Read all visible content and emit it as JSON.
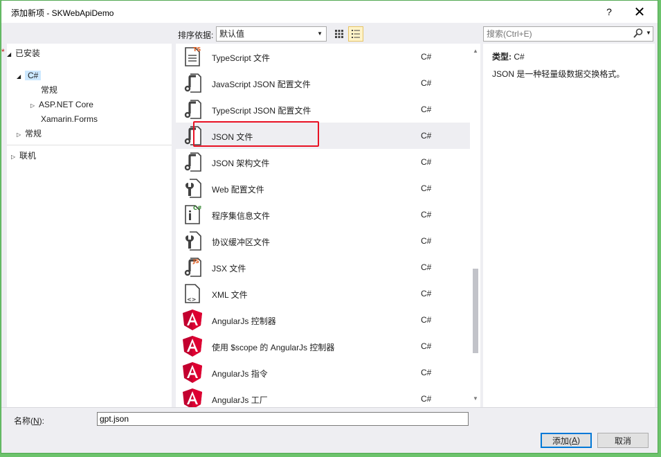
{
  "window": {
    "title": "添加新项 - SKWebApiDemo",
    "help_glyph": "?",
    "close_glyph": "✕"
  },
  "tree": {
    "installed_label": "已安装",
    "asterisk": "*",
    "items": [
      {
        "label": "C#",
        "arrow": "◢",
        "selected": true
      },
      {
        "label": "常规",
        "arrow": ""
      },
      {
        "label": "ASP.NET Core",
        "arrow": "▷"
      },
      {
        "label": "Xamarin.Forms",
        "arrow": ""
      },
      {
        "label": "常规",
        "arrow": "▷"
      },
      {
        "label": "联机",
        "arrow": "▷"
      }
    ]
  },
  "toolbar": {
    "sort_label": "排序依据:",
    "sort_value": "默认值",
    "grid_view_icon": "grid-view-icon",
    "list_view_icon": "list-view-icon"
  },
  "templates": [
    {
      "name": "TypeScript 文件",
      "lang": "C#",
      "icon": "typescript-file-icon"
    },
    {
      "name": "JavaScript JSON 配置文件",
      "lang": "C#",
      "icon": "json-config-icon"
    },
    {
      "name": "TypeScript JSON 配置文件",
      "lang": "C#",
      "icon": "json-config-icon"
    },
    {
      "name": "JSON 文件",
      "lang": "C#",
      "icon": "json-file-icon",
      "selected": true
    },
    {
      "name": "JSON 架构文件",
      "lang": "C#",
      "icon": "json-schema-icon"
    },
    {
      "name": "Web 配置文件",
      "lang": "C#",
      "icon": "web-config-icon"
    },
    {
      "name": "程序集信息文件",
      "lang": "C#",
      "icon": "assembly-info-icon"
    },
    {
      "name": "协议缓冲区文件",
      "lang": "C#",
      "icon": "protobuf-file-icon"
    },
    {
      "name": "JSX 文件",
      "lang": "C#",
      "icon": "jsx-file-icon"
    },
    {
      "name": "XML 文件",
      "lang": "C#",
      "icon": "xml-file-icon"
    },
    {
      "name": "AngularJs 控制器",
      "lang": "C#",
      "icon": "angular-icon"
    },
    {
      "name": "使用 $scope 的 AngularJs 控制器",
      "lang": "C#",
      "icon": "angular-icon"
    },
    {
      "name": "AngularJs 指令",
      "lang": "C#",
      "icon": "angular-icon"
    },
    {
      "name": "AngularJs 工厂",
      "lang": "C#",
      "icon": "angular-icon"
    }
  ],
  "search": {
    "placeholder": "搜索(Ctrl+E)"
  },
  "info": {
    "type_label": "类型:",
    "type_value": "C#",
    "description": "JSON 是一种轻量级数据交换格式。"
  },
  "footer": {
    "name_label_pre": "名称(",
    "name_label_key": "N",
    "name_label_post": "):",
    "name_value": "gpt.json",
    "add_pre": "添加(",
    "add_key": "A",
    "add_post": ")",
    "cancel_label": "取消"
  },
  "colors": {
    "accent": "#0078d7",
    "highlight_border": "#e81123",
    "window_border": "#52a852",
    "angular_red": "#c3002f",
    "ts_orange": "#e05a1b"
  }
}
